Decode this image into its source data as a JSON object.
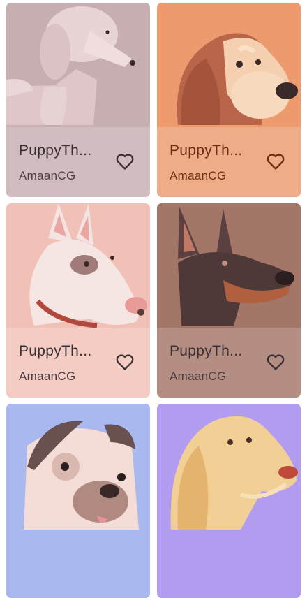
{
  "cards": [
    {
      "title": "PuppyTh...",
      "author": "AmaanCG",
      "art": "poodle",
      "bg": "#c7aeb1"
    },
    {
      "title": "PuppyTh...",
      "author": "AmaanCG",
      "art": "beagle",
      "bg": "#ec9a6e"
    },
    {
      "title": "PuppyTh...",
      "author": "AmaanCG",
      "art": "bull-terrier",
      "bg": "#f1c1b8"
    },
    {
      "title": "PuppyTh...",
      "author": "AmaanCG",
      "art": "doberman",
      "bg": "#a47667"
    },
    {
      "title": "",
      "author": "",
      "art": "pug",
      "bg": "#a9b8ee"
    },
    {
      "title": "",
      "author": "",
      "art": "golden-retriever",
      "bg": "#b29cf0"
    }
  ],
  "icons": {
    "favorite": "heart-outline-icon"
  }
}
